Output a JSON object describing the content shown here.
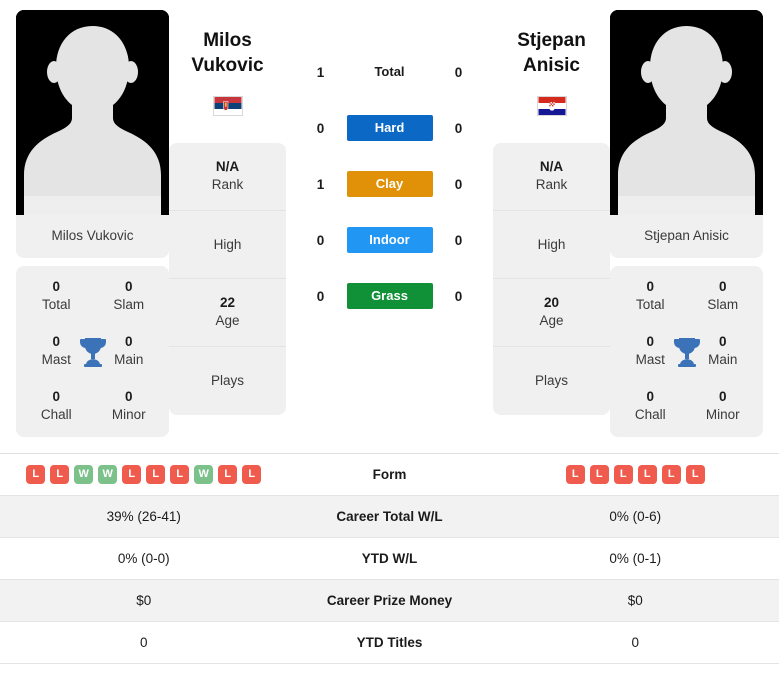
{
  "colors": {
    "hard": "#0b68c4",
    "clay": "#e09108",
    "indoor": "#2196f3",
    "grass": "#109138",
    "win_badge": "#7cc08a",
    "loss_badge": "#ef5b4c",
    "trophy": "#3c72b8",
    "card_bg": "#f0f0f0"
  },
  "players": {
    "left": {
      "name": "Milos Vukovic",
      "first_name": "Milos",
      "last_name": "Vukovic",
      "photo_caption": "Milos Vukovic",
      "country": "Serbia",
      "flag_icon": "flag-serbia",
      "titles": {
        "total_value": "0",
        "total_label": "Total",
        "slam_value": "0",
        "slam_label": "Slam",
        "mast_value": "0",
        "mast_label": "Mast",
        "main_value": "0",
        "main_label": "Main",
        "chall_value": "0",
        "chall_label": "Chall",
        "minor_value": "0",
        "minor_label": "Minor"
      },
      "info": {
        "rank_value": "N/A",
        "rank_label": "Rank",
        "high_label": "High",
        "high_value": "",
        "age_value": "22",
        "age_label": "Age",
        "plays_label": "Plays",
        "plays_value": ""
      },
      "surfaces": {
        "total": "1",
        "hard": "0",
        "clay": "1",
        "indoor": "0",
        "grass": "0"
      },
      "form": [
        "L",
        "L",
        "W",
        "W",
        "L",
        "L",
        "L",
        "W",
        "L",
        "L"
      ],
      "career_total_wl": "39% (26-41)",
      "ytd_wl": "0% (0-0)",
      "career_prize_money": "$0",
      "ytd_titles": "0"
    },
    "right": {
      "name": "Stjepan Anisic",
      "first_name": "Stjepan",
      "last_name": "Anisic",
      "photo_caption": "Stjepan Anisic",
      "country": "Croatia",
      "flag_icon": "flag-croatia",
      "titles": {
        "total_value": "0",
        "total_label": "Total",
        "slam_value": "0",
        "slam_label": "Slam",
        "mast_value": "0",
        "mast_label": "Mast",
        "main_value": "0",
        "main_label": "Main",
        "chall_value": "0",
        "chall_label": "Chall",
        "minor_value": "0",
        "minor_label": "Minor"
      },
      "info": {
        "rank_value": "N/A",
        "rank_label": "Rank",
        "high_label": "High",
        "high_value": "",
        "age_value": "20",
        "age_label": "Age",
        "plays_label": "Plays",
        "plays_value": ""
      },
      "surfaces": {
        "total": "0",
        "hard": "0",
        "clay": "0",
        "indoor": "0",
        "grass": "0"
      },
      "form": [
        "L",
        "L",
        "L",
        "L",
        "L",
        "L"
      ],
      "career_total_wl": "0% (0-6)",
      "ytd_wl": "0% (0-1)",
      "career_prize_money": "$0",
      "ytd_titles": "0"
    }
  },
  "surface_labels": {
    "total": "Total",
    "hard": "Hard",
    "clay": "Clay",
    "indoor": "Indoor",
    "grass": "Grass"
  },
  "table_labels": {
    "form": "Form",
    "career_total_wl": "Career Total W/L",
    "ytd_wl": "YTD W/L",
    "career_prize_money": "Career Prize Money",
    "ytd_titles": "YTD Titles"
  }
}
